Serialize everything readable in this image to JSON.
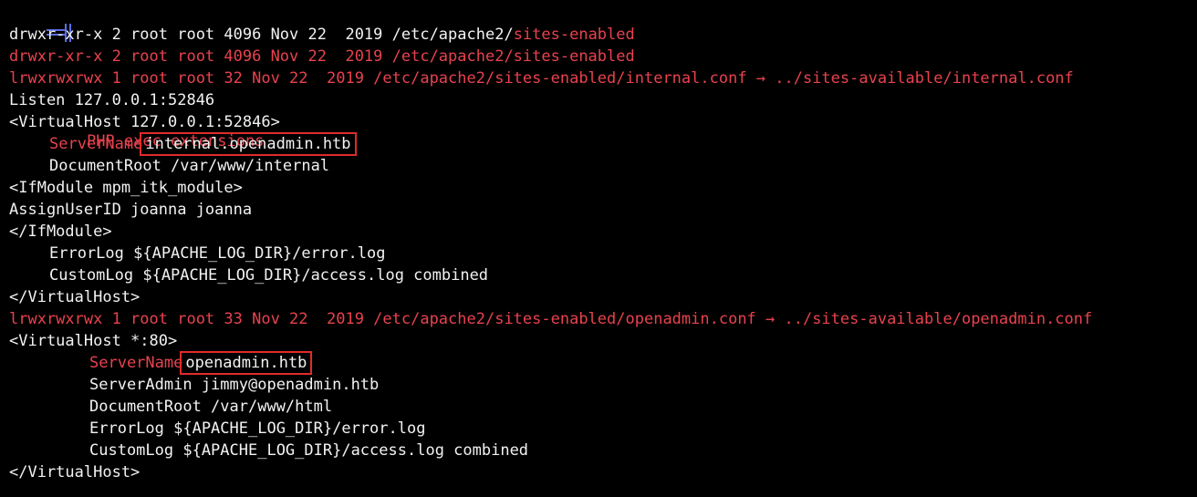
{
  "header": {
    "title": "PHP exec extensions"
  },
  "listing": {
    "dir_perms_white": "drwxr-xr-x 2 root root 4096 Nov 22  2019 /etc/apache2/",
    "dir_name_red": "sites-enabled",
    "dir_line_red": "drwxr-xr-x 2 root root 4096 Nov 22  2019 /etc/apache2/sites-enabled",
    "link_internal": "lrwxrwxrwx 1 root root 32 Nov 22  2019 /etc/apache2/sites-enabled/internal.conf → ../sites-available/internal.conf",
    "link_openadmin": "lrwxrwxrwx 1 root root 33 Nov 22  2019 /etc/apache2/sites-enabled/openadmin.conf → ../sites-available/openadmin.conf"
  },
  "internal_conf": {
    "listen": "Listen 127.0.0.1:52846",
    "vhost_open": "<VirtualHost 127.0.0.1:52846>",
    "servername_key": "ServerName",
    "servername_value": "internal.openadmin.htb",
    "docroot": "DocumentRoot /var/www/internal",
    "ifmodule_open": "<IfModule mpm_itk_module>",
    "assignuser": "AssignUserID joanna joanna",
    "ifmodule_close": "</IfModule>",
    "errorlog": "ErrorLog ${APACHE_LOG_DIR}/error.log",
    "customlog": "CustomLog ${APACHE_LOG_DIR}/access.log combined",
    "vhost_close": "</VirtualHost>"
  },
  "openadmin_conf": {
    "vhost_open": "<VirtualHost *:80>",
    "servername_key": "ServerName",
    "servername_value": "openadmin.htb",
    "serveradmin": "ServerAdmin jimmy@openadmin.htb",
    "docroot": "DocumentRoot /var/www/html",
    "errorlog": "ErrorLog ${APACHE_LOG_DIR}/error.log",
    "customlog": "CustomLog ${APACHE_LOG_DIR}/access.log combined",
    "vhost_close": "</VirtualHost>"
  },
  "colors": {
    "background": "#000000",
    "text": "#f2f2f2",
    "accent_red": "#e8424e",
    "highlight_box": "#e02b2b",
    "icon_blue": "#5b6ee8"
  },
  "icons": {
    "header": "tree-branch-icon"
  }
}
